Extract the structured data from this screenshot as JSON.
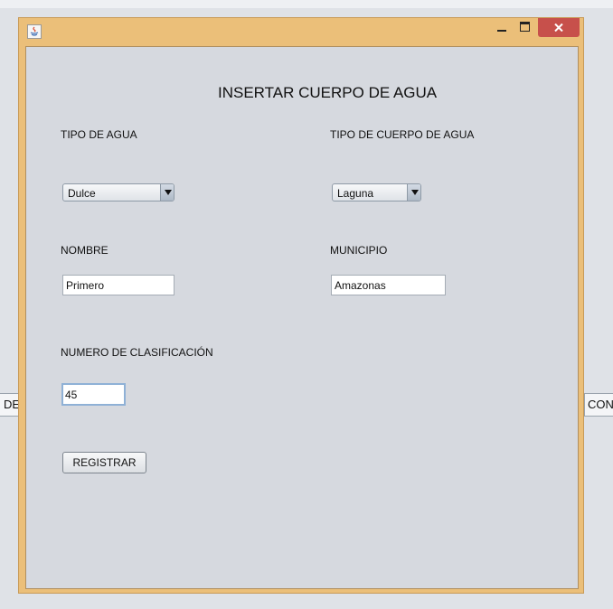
{
  "background": {
    "left_button_label": "DE",
    "right_button_label": "CON"
  },
  "window": {
    "title": "",
    "icon": "java-icon",
    "controls": {
      "minimize": "minimize-icon",
      "maximize": "maximize-icon",
      "close": "close-icon"
    },
    "accent_color": "#ebbf79",
    "close_color": "#c7504b"
  },
  "form": {
    "heading": "INSERTAR CUERPO DE AGUA",
    "tipo_agua": {
      "label": "TIPO DE AGUA",
      "selected": "Dulce"
    },
    "tipo_cuerpo": {
      "label": "TIPO DE CUERPO DE AGUA",
      "selected": "Laguna"
    },
    "nombre": {
      "label": "NOMBRE",
      "value": "Primero"
    },
    "municipio": {
      "label": "MUNICIPIO",
      "value": "Amazonas"
    },
    "clasificacion": {
      "label": "NUMERO DE CLASIFICACIÓN",
      "value": "45"
    },
    "register_label": "REGISTRAR"
  }
}
